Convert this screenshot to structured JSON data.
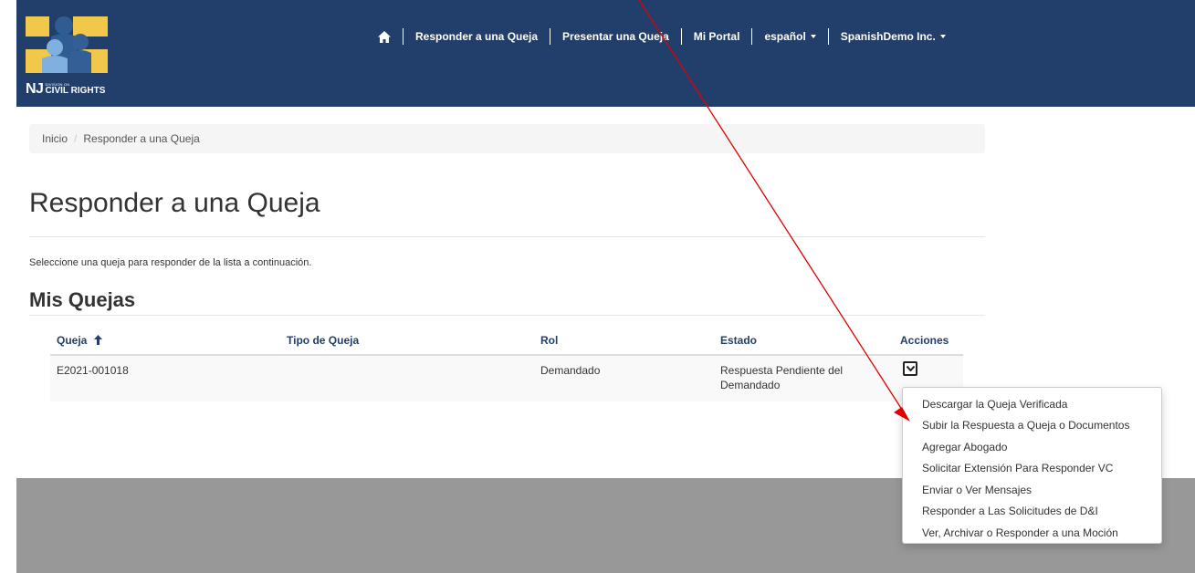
{
  "header": {
    "logo": {
      "prefix": "NJ",
      "small_text": "DIVISION ON",
      "main_text": "CIVIL RIGHTS",
      "colors": {
        "gold": "#f2c84b",
        "blue_light": "#6a9bd0",
        "blue_dark": "#2f5d93"
      }
    },
    "nav": {
      "home_icon": "home-icon",
      "items": [
        {
          "label": "Responder a una Queja"
        },
        {
          "label": "Presentar una Queja"
        },
        {
          "label": "Mi Portal"
        },
        {
          "label": "español"
        },
        {
          "label": "SpanishDemo Inc."
        }
      ]
    },
    "bg_color": "#223f6b"
  },
  "breadcrumb": {
    "home": "Inicio",
    "separator": "/",
    "current": "Responder a una Queja"
  },
  "page": {
    "title": "Responder a una Queja",
    "intro": "Seleccione una queja para responder de la lista a continuación.",
    "section_title": "Mis Quejas"
  },
  "table": {
    "columns": [
      "Queja",
      "Tipo de Queja",
      "Rol",
      "Estado",
      "Acciones"
    ],
    "rows": [
      {
        "queja": "E2021-001018",
        "tipo": "",
        "rol": "Demandado",
        "estado_line1": "Respuesta Pendiente del",
        "estado_line2": "Demandado"
      }
    ]
  },
  "actions_menu": {
    "items": [
      "Descargar la Queja Verificada",
      "Subir la Respuesta a Queja o Documentos",
      "Agregar Abogado",
      "Solicitar Extensión Para Responder VC",
      "Enviar o Ver Mensajes",
      "Responder a Las Solicitudes de D&I",
      "Ver, Archivar o Responder a una Moción"
    ]
  },
  "colors": {
    "link": "#223f6b",
    "footer": "#989898",
    "annotation": "#e00000"
  }
}
